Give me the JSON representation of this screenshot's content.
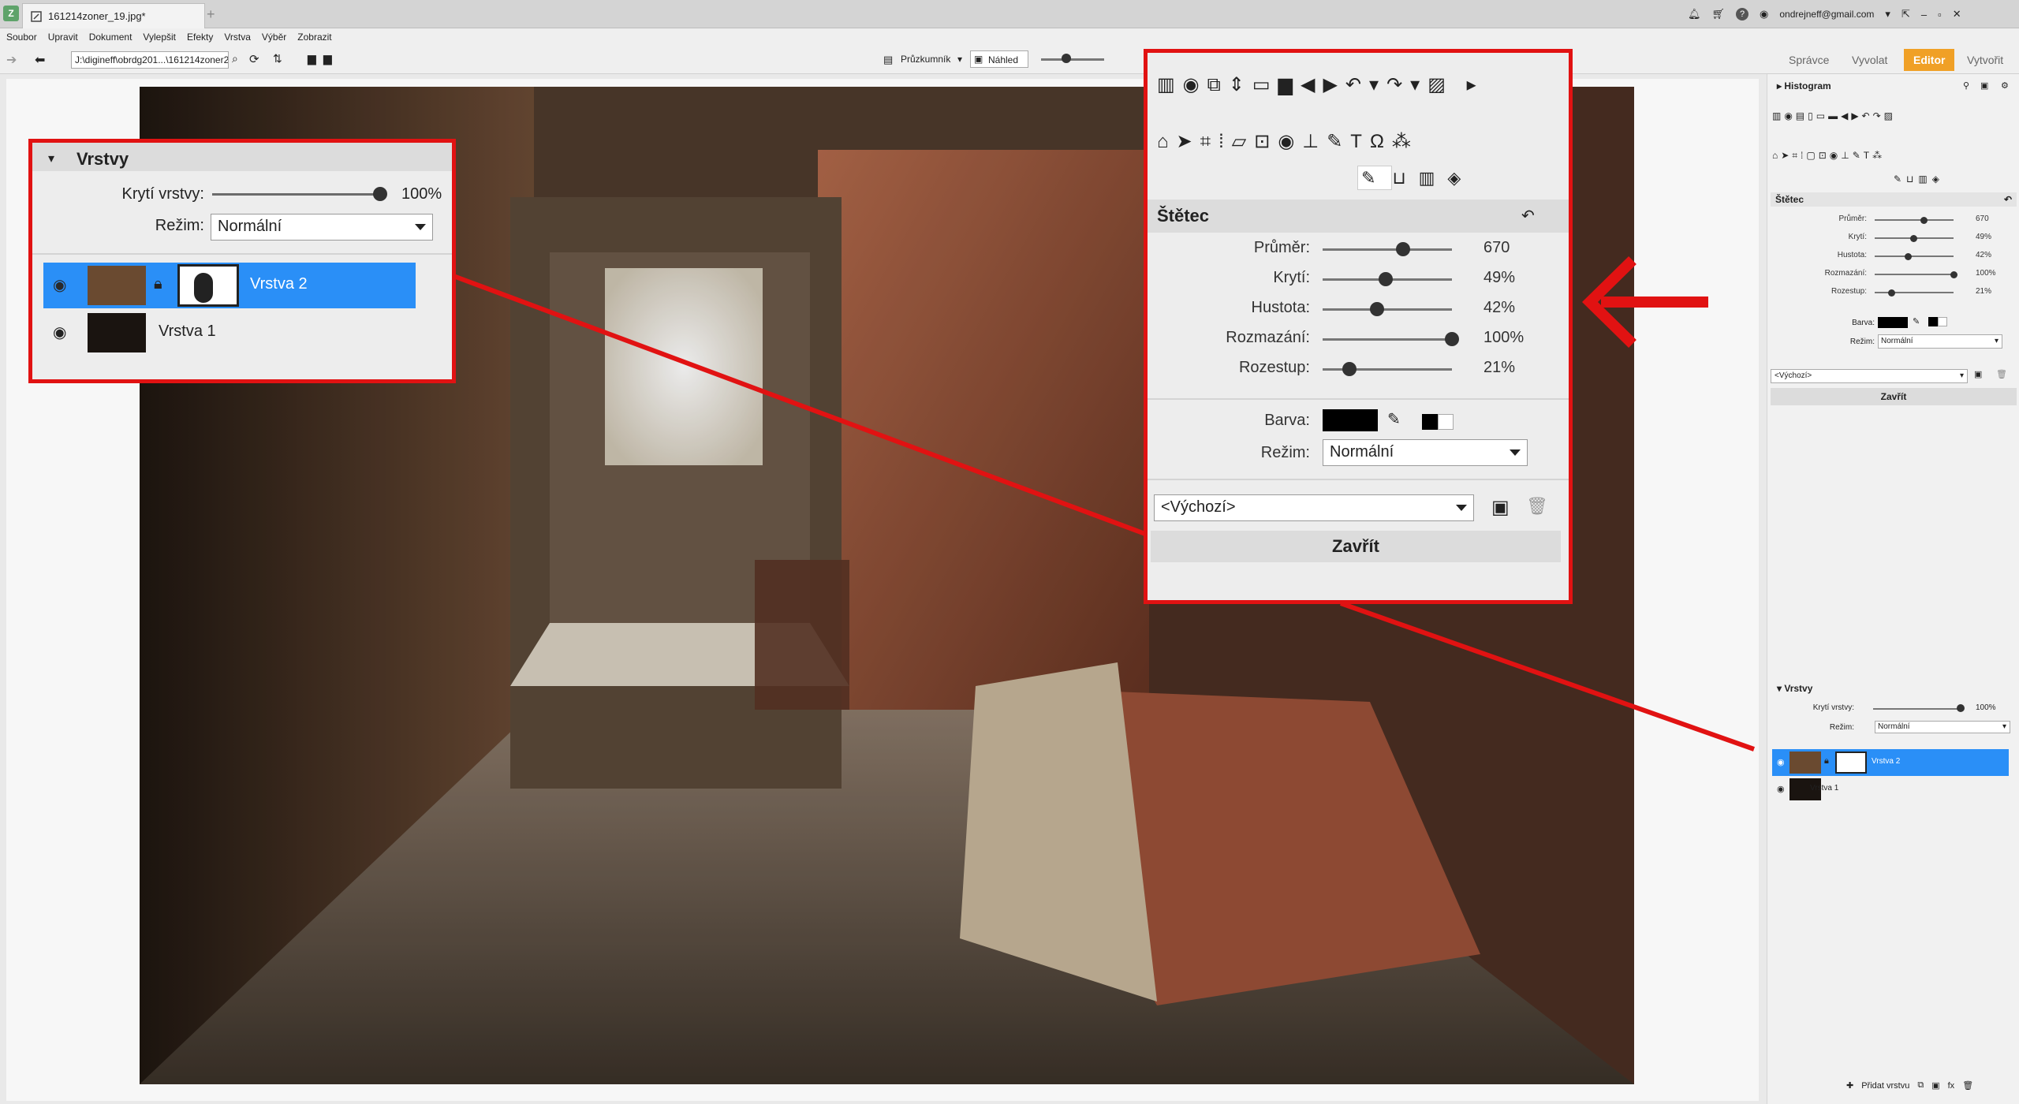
{
  "window": {
    "tab_title": "161214zoner_19.jpg*",
    "user_email": "ondrejneff@gmail.com"
  },
  "menu": [
    "Soubor",
    "Upravit",
    "Dokument",
    "Vylepšit",
    "Efekty",
    "Vrstva",
    "Výběr",
    "Zobrazit"
  ],
  "nav": {
    "path": "J:\\digineff\\obrdg201...\\161214zoner2",
    "explorer_label": "Průzkumník",
    "preview_label": "Náhled"
  },
  "modes": [
    "Správce",
    "Vyvolat",
    "Editor",
    "Vytvořit"
  ],
  "active_mode": "Editor",
  "right_panel": {
    "histogram_label": "Histogram",
    "brush": {
      "title": "Štětec",
      "params": [
        {
          "label": "Průměr:",
          "value": "670",
          "fraction": 0.62
        },
        {
          "label": "Krytí:",
          "value": "49%",
          "fraction": 0.49
        },
        {
          "label": "Hustota:",
          "value": "42%",
          "fraction": 0.42
        },
        {
          "label": "Rozmazání:",
          "value": "100%",
          "fraction": 1.0
        },
        {
          "label": "Rozestup:",
          "value": "21%",
          "fraction": 0.21
        }
      ],
      "color_label": "Barva:",
      "mode_label": "Režim:",
      "mode_value": "Normální",
      "preset_value": "<Výchozí>",
      "close_label": "Zavřít"
    },
    "layers": {
      "title": "Vrstvy",
      "opacity_label": "Krytí vrstvy:",
      "opacity_value": "100%",
      "opacity_fraction": 1.0,
      "mode_label": "Režim:",
      "mode_value": "Normální",
      "items": [
        {
          "name": "Vrstva 2",
          "selected": true
        },
        {
          "name": "Vrstva 1",
          "selected": false
        }
      ],
      "add_layer_label": "Přidat vrstvu"
    }
  },
  "colors": {
    "accent_red": "#e11212",
    "selected_layer": "#2a8ff7",
    "editor_tab": "#f0a026"
  }
}
